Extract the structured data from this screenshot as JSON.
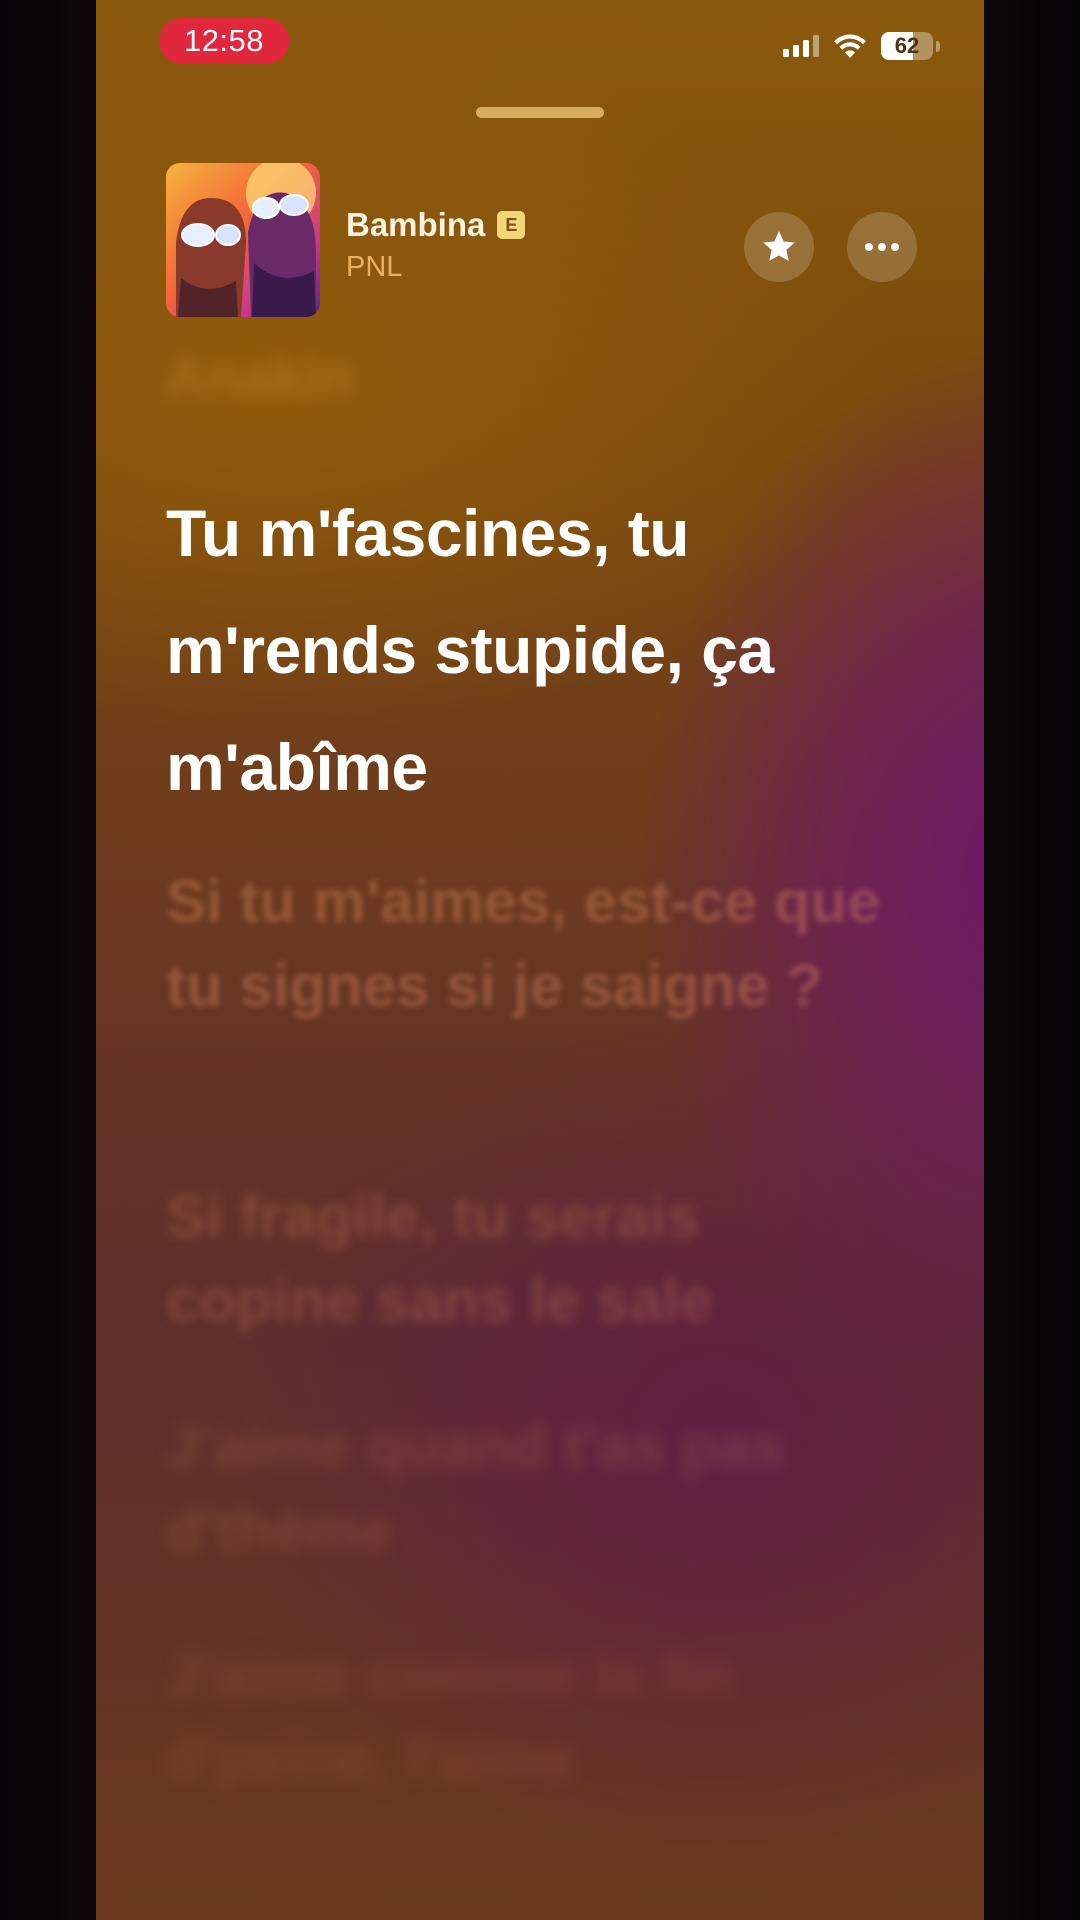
{
  "status_bar": {
    "time": "12:58",
    "battery_level": "62",
    "battery_fraction": 0.62
  },
  "player": {
    "title": "Bambina",
    "explicit_badge": "E",
    "artist": "PNL",
    "favorite_icon": "star-icon",
    "more_icon": "ellipsis-icon"
  },
  "lyrics": {
    "previous": "Anakin",
    "current": "Tu m'fascines, tu m'rends stupide, ça m'abîme",
    "upcoming": [
      "Si tu m'aimes, est-ce que tu signes si je saigne ?",
      "Si fragile, tu serais copine sans le sale",
      "J'aime quand t'as pas d'thème",
      "J'aime comme la fin d'peine, l'aime"
    ]
  },
  "colors": {
    "time_pill": "#e0273d",
    "explicit_badge": "#f2d77a",
    "artist_text": "#e8b060"
  }
}
